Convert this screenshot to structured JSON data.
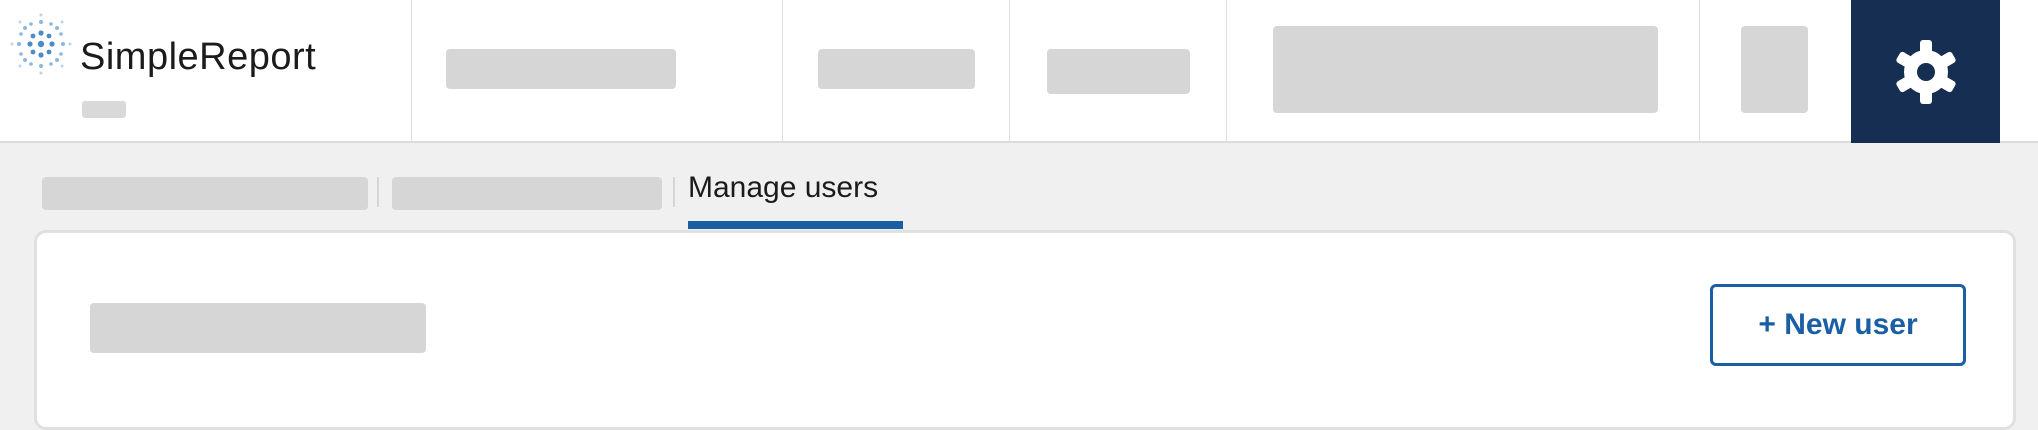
{
  "app": {
    "name": "SimpleReport",
    "logo_icon": "dot-sunburst-logo-icon"
  },
  "header": {
    "settings_icon": "gear-icon"
  },
  "tabs": {
    "active_label": "Manage users"
  },
  "card": {
    "new_user_button": "+ New user"
  },
  "colors": {
    "brand_navy": "#162e51",
    "accent_blue": "#1a5fa4",
    "placeholder_gray": "#d6d6d6",
    "page_background": "#f0f0f0"
  }
}
